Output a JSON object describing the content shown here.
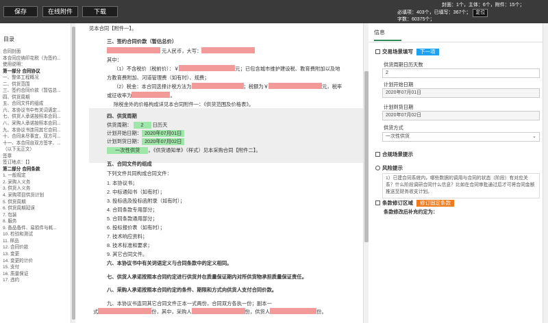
{
  "toolbar": {
    "save": "保存",
    "online_attachment": "在线附件",
    "download": "下载"
  },
  "stats": {
    "line1": "封面：1个，主体：6个，附件：15个；",
    "required_label": "必填项：403个，已填写：367个；",
    "locate": "定位",
    "word_count": "字数：60375个；"
  },
  "toc": {
    "title": "目录",
    "items": [
      {
        "t": "合同封面",
        "b": false
      },
      {
        "t": "本合同应纳印花税（为签约...",
        "b": false
      },
      {
        "t": "使用说明：",
        "b": false
      },
      {
        "t": "第一部分  合同协议",
        "b": true
      },
      {
        "t": "一、整体工程概况",
        "b": false
      },
      {
        "t": "二、供货范围",
        "b": false
      },
      {
        "t": "三、签约合同价款（暂估总...",
        "b": false
      },
      {
        "t": "四、供货周期",
        "b": false
      },
      {
        "t": "五、合同文件的组成",
        "b": false
      },
      {
        "t": "六、本协议书中有关词语定...",
        "b": false
      },
      {
        "t": "七、供货人承诺按照本合同...",
        "b": false
      },
      {
        "t": "八、采购人承诺按照本合同...",
        "b": false
      },
      {
        "t": "九、本协议书连同其它合同...",
        "b": false
      },
      {
        "t": "十、合同未尽事宜，双方可...",
        "b": false
      },
      {
        "t": "十一、本合同自双方签字、...",
        "b": false
      },
      {
        "t": "（以下无正文）",
        "b": false
      },
      {
        "t": "签章",
        "b": false
      },
      {
        "t": "签订地点：【】",
        "b": false
      },
      {
        "t": "第二部分  合同条款",
        "b": true
      },
      {
        "t": "1. 一般规定",
        "b": false
      },
      {
        "t": "2. 采购人义务",
        "b": false
      },
      {
        "t": "3. 供货人义务",
        "b": false
      },
      {
        "t": "4. 采购项目供货计划",
        "b": false
      },
      {
        "t": "5. 供货周期",
        "b": false
      },
      {
        "t": "6. 供货周期延误",
        "b": false
      },
      {
        "t": "7. 包装",
        "b": false
      },
      {
        "t": "8. 服务",
        "b": false
      },
      {
        "t": "9. 备品备件、易损件与耗...",
        "b": false
      },
      {
        "t": "10. 检验和测试",
        "b": false
      },
      {
        "t": "11. 样品",
        "b": false
      },
      {
        "t": "12. 合同价款",
        "b": false
      },
      {
        "t": "13. 变更",
        "b": false
      },
      {
        "t": "14. 变更的计价",
        "b": false
      },
      {
        "t": "15. 支付",
        "b": false
      },
      {
        "t": "16. 质量保证",
        "b": false
      },
      {
        "t": "17. 违约",
        "b": false
      }
    ]
  },
  "doc": {
    "attach1": "见本合同【附件一】。",
    "s3_title": "三、签约合同价款（暂估总价）",
    "rmb_text": "元人民币，大写：",
    "qizhong": "其中：",
    "p1a": "（1）不含税价（税前价）：￥",
    "p1b": "元；已包含城市维护建设税、教育费附加以及地",
    "p1c": "方教育费附加、河道管理费（如有时）、规费；",
    "p2a": "（2）税金：本合同选择计税方法为",
    "p2b": "；税额为￥",
    "p2c": "元，税率",
    "p2d": "或征收率为",
    "p2e": "。",
    "p3": "除税金外的价格构成详见本合同附件一：《供货范围及价格表》。",
    "s4_title": "四、供货周期",
    "cycle_label": "供货周期：",
    "cycle_value": "2",
    "cycle_unit": "日历天",
    "start_label": "计划开始日期：",
    "start_value": "2020年07月01日",
    "end_label": "计划到货日期：",
    "end_value": "2020年07月02日",
    "supply_mode": "一次性供货",
    "supply_note": "。《供货通知单》（样式）见本采购合同【附件二】。",
    "s5_title": "五、合同文件的组成",
    "s5_intro": "下列文件共同构成合同文件：",
    "s5_items": [
      "1. 本协议书；",
      "2. 中标通知书（如有时）；",
      "3. 投标函及投标函附录（如有时）；",
      "4. 合同条款专用部分；",
      "5. 合同条款通用部分；",
      "6. 投标报价表（如有时）；",
      "7. 技术响应资料；",
      "8. 技术标准和要求；",
      "9. 其它合同文件。"
    ],
    "s6": "六、本协议书中有关词语定义与合同条款中的定义相同。",
    "s7": "七、供货人承诺按照本合同约定进行供货并在质量保证期内对所供货物承担质量保证责任。",
    "s8": "八、采购人承诺按照本合同约定的条件、期限和方式向供货人支付合同价款。",
    "s9a": "九、本协议书连同其它合同文件正本一式两份，合同双方各执一份；副本一",
    "s9b": "式",
    "s9c": "份，其中，采购人",
    "s9d": "份，供货人",
    "s9e": "份。"
  },
  "right": {
    "tab": "信息",
    "sec1": "交易场景填写",
    "sec1_badge": "下一项",
    "f1_label": "供货周期日历天数",
    "f1_value": "2",
    "f2_label": "计划开始日期",
    "f2_value": "2020年07月01日",
    "f3_label": "计划到货日期",
    "f3_value": "2020年07月02日",
    "f4_label": "供货方式",
    "f4_value": "一次性供货",
    "sec2": "合规场景提示",
    "sec3": "风险提示",
    "risk_text": "1）已建合同系统内，哪些数据的调用与合同的状态（阶段）有对应关系？什么阶段调研合同什么信息？比如在合同审批通过后才可将合同金额推送至财务收支计划。",
    "sec4": "条款修订区域",
    "sec4_badge": "修订固定条款",
    "sec4_text": "条款修改后补充约定为："
  },
  "colors": {
    "badge_blue": "#1ea1f1",
    "badge_orange": "#f07b1d",
    "highlight_red": "#f29a9a",
    "highlight_green": "#9fe7a8",
    "accent_green": "#2e8b57"
  }
}
